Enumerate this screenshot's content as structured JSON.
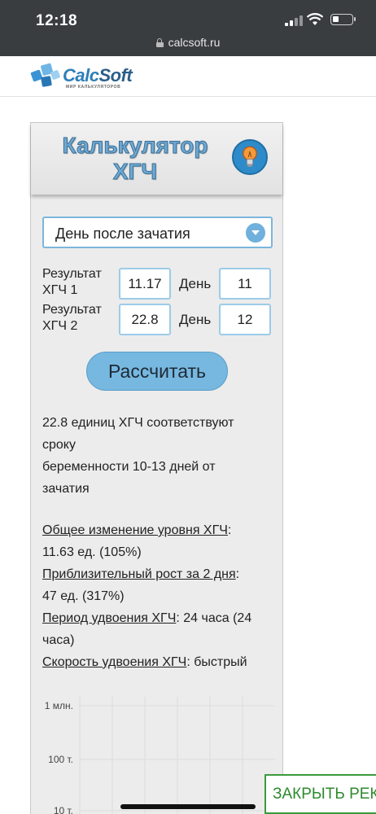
{
  "status": {
    "time": "12:18"
  },
  "browser": {
    "url": "calcsoft.ru"
  },
  "site": {
    "logo_calc": "Calc",
    "logo_soft": "Soft",
    "logo_sub": "МИР КАЛЬКУЛЯТОРОВ"
  },
  "calculator": {
    "title_line1": "Калькулятор",
    "title_line2": "ХГЧ",
    "mode_select": "День после зачатия",
    "row1": {
      "label_line1": "Результат",
      "label_line2": "ХГЧ 1",
      "value": "11.17",
      "day_label": "День",
      "day": "11"
    },
    "row2": {
      "label_line1": "Результат",
      "label_line2": "ХГЧ 2",
      "value": "22.8",
      "day_label": "День",
      "day": "12"
    },
    "button_label": "Рассчитать"
  },
  "result": {
    "line1": "22.8 единиц ХГЧ соответствуют",
    "line2": "сроку",
    "line3": "беременности 10-13 дней от",
    "line4": "зачатия",
    "total_change_label": "Общее изменение уровня ХГЧ",
    "total_change_value": "11.63 ед. (105%)",
    "growth_label": "Приблизительный рост за 2 дня",
    "growth_value": "47 ед. (317%)",
    "doubling_period_label": "Период удвоения ХГЧ",
    "doubling_period_value": "24 часа (24",
    "doubling_period_value2": "часа)",
    "doubling_speed_label": "Скорость удвоения ХГЧ",
    "doubling_speed_value": "быстрый"
  },
  "chart_data": {
    "type": "line",
    "y_tick_labels": [
      "1 млн.",
      "100 т.",
      "10 т."
    ],
    "grid": true,
    "yscale": "log"
  },
  "ad": {
    "close_label": "ЗАКРЫТЬ РЕК"
  }
}
